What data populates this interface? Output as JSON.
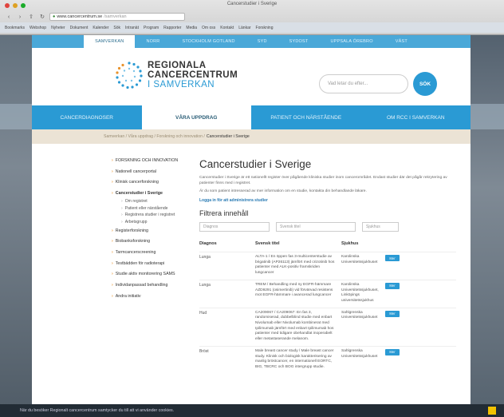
{
  "browser": {
    "title": "Cancerstudier i Sverige",
    "url": "www.cancercentrum.se",
    "url_suffix": "/samverkan",
    "bookmarks": [
      "Bookmarks",
      "Webshop",
      "Nyheter",
      "Dokument",
      "Kalender",
      "Sök",
      "Intranät",
      "Program",
      "Rapporter",
      "Media",
      "Om oss",
      "Kontakt",
      "Länkar",
      "Forskning"
    ]
  },
  "topnav": [
    "SAMVERKAN",
    "NORR",
    "STOCKHOLM GOTLAND",
    "SYD",
    "SYDOST",
    "UPPSALA ÖREBRO",
    "VÄST"
  ],
  "logo": {
    "line1": "REGIONALA",
    "line2": "CANCERCENTRUM",
    "line3": "I SAMVERKAN"
  },
  "search": {
    "placeholder": "Vad letar du efter...",
    "button": "SÖK"
  },
  "mainnav": [
    "CANCERDIAGNOSER",
    "VÅRA UPPDRAG",
    "PATIENT OCH NÄRSTÅENDE",
    "OM RCC I SAMVERKAN"
  ],
  "breadcrumb": {
    "path": "Samverkan / Våra uppdrag / Forskning och innovation /",
    "current": "Cancerstudier i Sverige"
  },
  "sidebar": {
    "items": [
      "FORSKNING OCH INNOVATION",
      "Nationell cancerportal",
      "Klinisk cancerforskning",
      "Cancerstudier i Sverige"
    ],
    "subitems": [
      "Om registret",
      "Patient eller närstående",
      "Registrera studier i registret",
      "Arbetsgrupp"
    ],
    "more": [
      "Registerforskning",
      "Biobanksforskning",
      "Tarmcancerscreening",
      "Testbädden för radioterapi",
      "Studie aktiv monitorering SAMS",
      "Individanpassad behandling",
      "Andra initiativ"
    ]
  },
  "main": {
    "title": "Cancerstudier i Sverige",
    "intro1": "Cancerstudier i Sverige är ett nationellt register över pågående kliniska studier inom cancerområdet. Endast studier där det pågår rekrytering av patienter finns med i registret.",
    "intro2": "Är du som patient intresserad av mer information om en studie, kontakta din behandlande läkare.",
    "login_link": "Logga in för att administrera studier",
    "filter_title": "Filtrera innehåll",
    "filters": {
      "diagnos": "Diagnos",
      "svensk_titel": "Svensk titel",
      "sjukhus": "Sjukhus"
    },
    "headers": [
      "Diagnos",
      "Svensk titel",
      "Sjukhus"
    ],
    "rows": [
      {
        "diagnos": "Lunga",
        "titel": "ALTA-1 / En öppen fas 3-multicenterstudie av brigatinib (AP26113) jämfört med crizotinib hos patienter med ALK-positiv framskriden lungcancer",
        "sjukhus": "Karolinska Universitetssjukhuset",
        "btn": "Mer"
      },
      {
        "diagnos": "Lunga",
        "titel": "TREM / Behandling med ny EGFR-hämmare AZD9291 (osimertinib) vid förvärvad resistens mot EGFR-hämmare i avancerad lungcancer",
        "sjukhus": "Karolinska Universitetssjukhuset, Linköpings universitetssjukhus",
        "btn": "Mer"
      },
      {
        "diagnos": "Hud",
        "titel": "CA209067 / CA209067: En fas 3, randomiserad, dubbelblind studie med enbart Nivolumab eller Nivolumab kombinerat med Ipilimumab jämfört med enbart Ipilimumab hos patienter med tidigare obehandlat inoperabelt eller metastaserande melanom.",
        "sjukhus": "Sahlgrenska Universitetssjukhuset",
        "btn": "Mer"
      },
      {
        "diagnos": "Bröst",
        "titel": "Male breast cancer study / Male breast cancer study. Klinisk och biologisk karakterisering av manlig bröstcancer, en internationell EORTC, BIG, TBCRC och BOG intergrupp studie.",
        "sjukhus": "Sahlgrenska Universitetssjukhuset",
        "btn": "Mer"
      }
    ]
  },
  "cookie": "När du besöker Regionalt cancercentrum samtycker du till att vi använder cookies.",
  "colors": {
    "brand_blue": "#2a9ad4",
    "accent_orange": "#e8922b",
    "breadcrumb_bg": "#ebe3d5"
  }
}
